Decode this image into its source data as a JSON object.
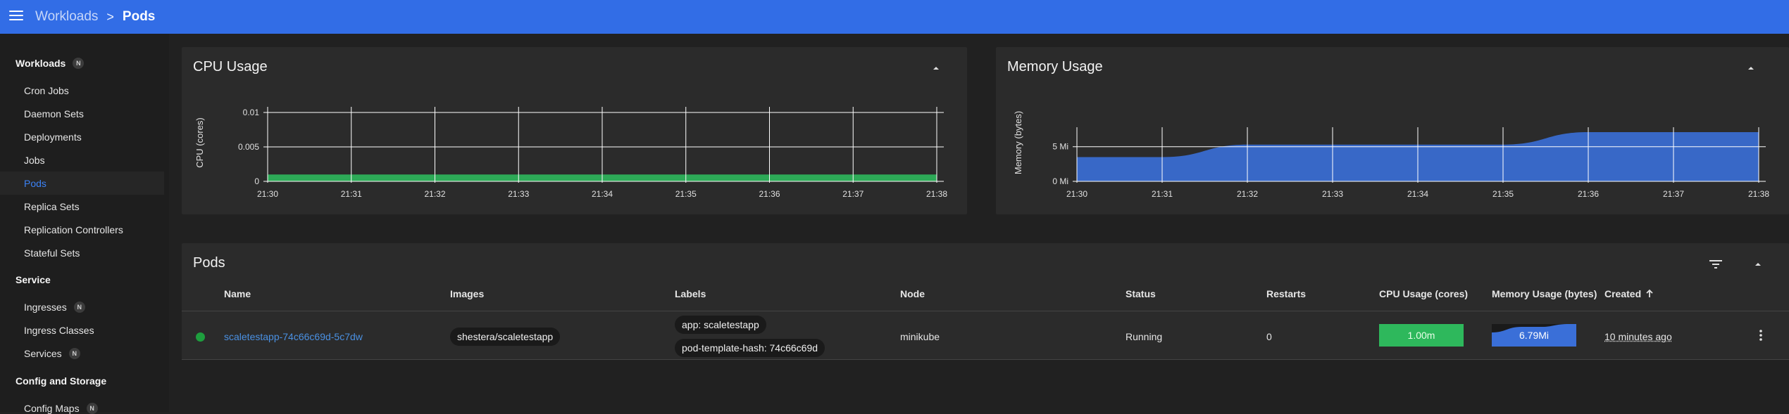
{
  "colors": {
    "header": "#326de6",
    "link": "#4a90e2",
    "running": "#1e9e3e",
    "cpu": "#2eb85c",
    "memory": "#3a6fd8"
  },
  "header": {
    "menu_icon": "menu-icon",
    "breadcrumb": {
      "parent": "Workloads",
      "separator": ">",
      "current": "Pods"
    }
  },
  "sidebar": {
    "groups": [
      {
        "label": "Workloads",
        "badge": "N",
        "items": [
          "Cron Jobs",
          "Daemon Sets",
          "Deployments",
          "Jobs",
          "Pods",
          "Replica Sets",
          "Replication Controllers",
          "Stateful Sets"
        ]
      },
      {
        "label": "Service",
        "badge": "",
        "items": [
          "Ingresses",
          "Ingress Classes",
          "Services"
        ],
        "item_badges": {
          "Ingresses": "N",
          "Services": "N"
        }
      },
      {
        "label": "Config and Storage",
        "badge": "",
        "items": [
          "Config Maps"
        ],
        "item_badges": {
          "Config Maps": "N"
        }
      }
    ],
    "active_item": "Pods"
  },
  "cpu_card": {
    "title": "CPU Usage",
    "collapse_icon": "chevron-up-icon"
  },
  "memory_card": {
    "title": "Memory Usage",
    "collapse_icon": "chevron-up-icon"
  },
  "chart_data": [
    {
      "type": "area",
      "title": "CPU Usage",
      "xlabel": "",
      "ylabel": "CPU (cores)",
      "x": [
        "21:30",
        "21:31",
        "21:32",
        "21:33",
        "21:34",
        "21:35",
        "21:36",
        "21:37",
        "21:38"
      ],
      "y_ticks": [
        "0",
        "0.005",
        "0.01"
      ],
      "ylim": [
        0,
        0.01
      ],
      "grid": true,
      "series": [
        {
          "values": [
            0.001,
            0.001,
            0.001,
            0.001,
            0.001,
            0.001,
            0.001,
            0.001,
            0.001
          ],
          "color": "#2eb85c"
        }
      ]
    },
    {
      "type": "area",
      "title": "Memory Usage",
      "xlabel": "",
      "ylabel": "Memory (bytes)",
      "x": [
        "21:30",
        "21:31",
        "21:32",
        "21:33",
        "21:34",
        "21:35",
        "21:36",
        "21:37",
        "21:38"
      ],
      "y_ticks": [
        "0 Mi",
        "5 Mi"
      ],
      "ylim": [
        0,
        7
      ],
      "grid": true,
      "series": [
        {
          "values": [
            3.5,
            3.5,
            5.3,
            5.3,
            5.3,
            5.3,
            7.1,
            7.1,
            7.1
          ],
          "color": "#3a6fd8",
          "unit": "Mi"
        }
      ]
    }
  ],
  "pods_card": {
    "title": "Pods",
    "filter_icon": "filter-icon",
    "collapse_icon": "chevron-up-icon",
    "columns": [
      "Name",
      "Images",
      "Labels",
      "Node",
      "Status",
      "Restarts",
      "CPU Usage (cores)",
      "Memory Usage (bytes)",
      "Created"
    ],
    "sort_icon": "arrow-up-icon",
    "rows": [
      {
        "name": "scaletestapp-74c66c69d-5c7dw",
        "image": "shestera/scaletestapp",
        "labels": [
          "app: scaletestapp",
          "pod-template-hash: 74c66c69d"
        ],
        "node": "minikube",
        "status": "Running",
        "restarts": "0",
        "cpu": "1.00m",
        "memory": "6.79Mi",
        "created": "10 minutes ago",
        "actions_icon": "more-vert-icon"
      }
    ]
  }
}
